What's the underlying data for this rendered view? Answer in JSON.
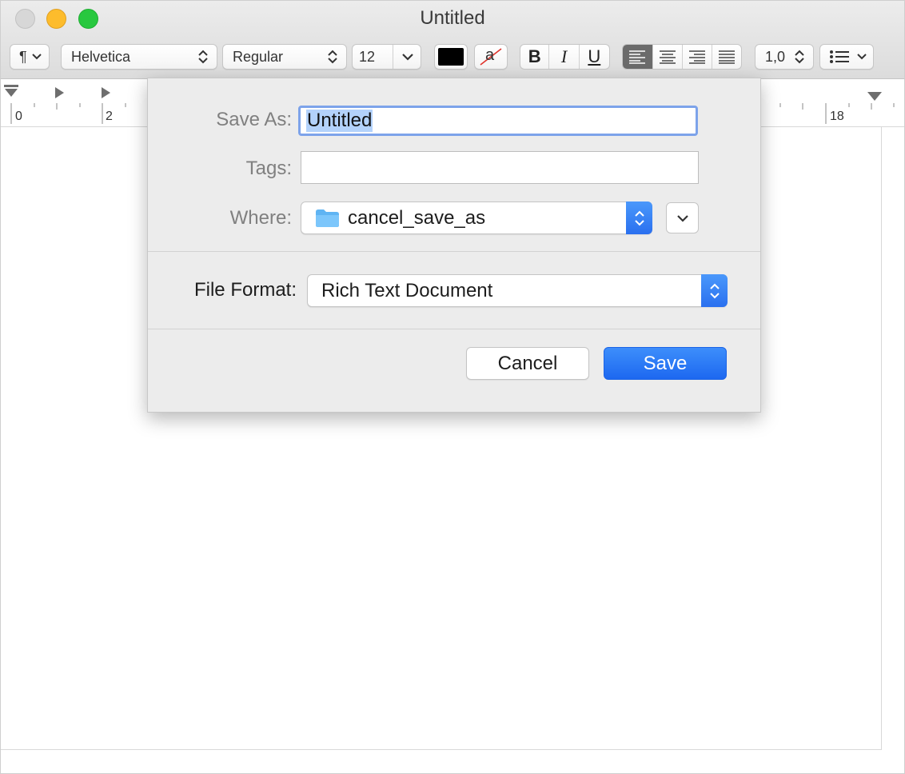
{
  "window": {
    "title": "Untitled"
  },
  "toolbar": {
    "paragraph_style_symbol": "¶",
    "font_family": "Helvetica",
    "font_style": "Regular",
    "font_size": "12",
    "bold_label": "B",
    "italic_label": "I",
    "underline_label": "U",
    "highlight_glyph": "a",
    "line_spacing": "1,0",
    "text_color": "#000000",
    "selected_alignment": "left"
  },
  "ruler": {
    "labels": [
      "0",
      "2",
      "18"
    ]
  },
  "save_dialog": {
    "save_as_label": "Save As:",
    "save_as_value": "Untitled",
    "tags_label": "Tags:",
    "tags_value": "",
    "where_label": "Where:",
    "where_value": "cancel_save_as",
    "file_format_label": "File Format:",
    "file_format_value": "Rich Text Document",
    "cancel_label": "Cancel",
    "save_label": "Save"
  },
  "colors": {
    "accent": "#2a70ef",
    "selection": "#b3d2fb",
    "focus_ring": "#7da3ea",
    "close": "#d7d7d7",
    "minimize": "#fdbc2c",
    "maximize": "#28c83f"
  }
}
